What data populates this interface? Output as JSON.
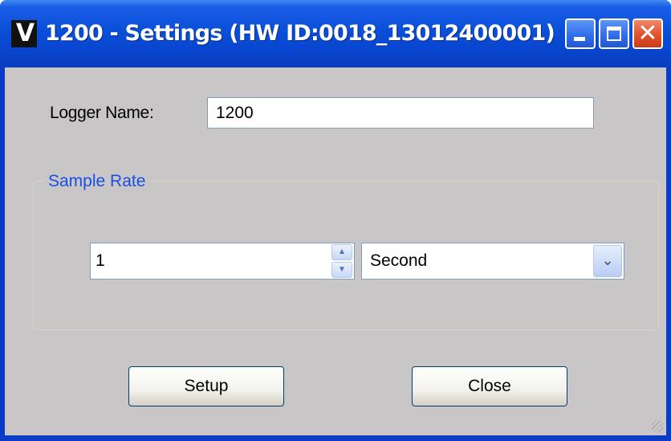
{
  "window": {
    "title": "1200 - Settings (HW ID:0018_13012400001)",
    "app_icon_glyph": "V",
    "controls": {
      "minimize": "minimize-icon",
      "maximize": "maximize-icon",
      "close": "close-icon"
    }
  },
  "form": {
    "logger_name_label": "Logger Name:",
    "logger_name_value": "1200"
  },
  "sample_rate": {
    "group_title": "Sample Rate",
    "value": "1",
    "unit": "Second"
  },
  "buttons": {
    "setup": "Setup",
    "close": "Close"
  },
  "colors": {
    "titlebar": "#0a4fd8",
    "client_bg": "#c8c6c7",
    "group_title": "#1a4fe0",
    "close_button": "#e2552f"
  }
}
